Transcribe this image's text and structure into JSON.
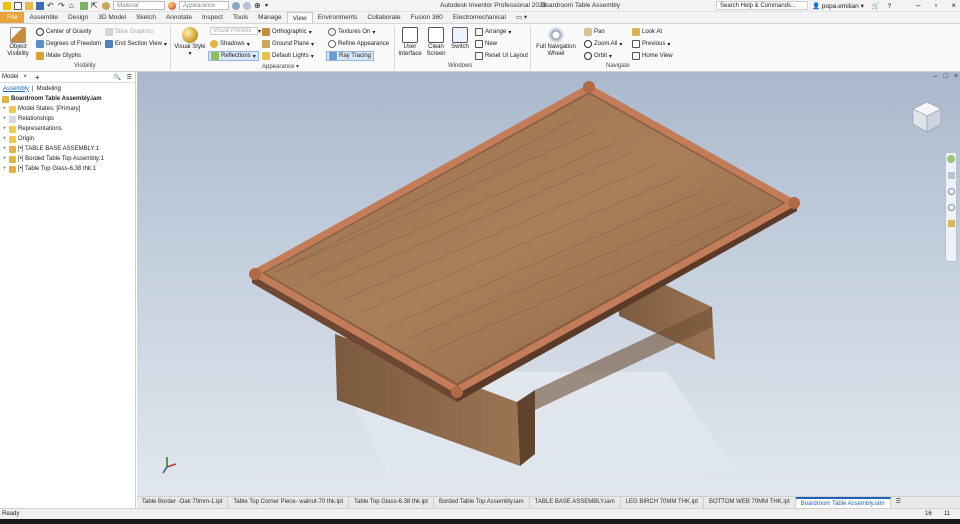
{
  "titlebar": {
    "material_placeholder": "Material",
    "appearance_placeholder": "Appearance",
    "app_title": "Autodesk Inventor Professional 2023",
    "doc_title": "Boardroom Table Assembly",
    "search_placeholder": "Search Help & Commands...",
    "user": "popa.emilian"
  },
  "tabs": [
    "File",
    "Assemble",
    "Design",
    "3D Model",
    "Sketch",
    "Annotate",
    "Inspect",
    "Tools",
    "Manage",
    "View",
    "Environments",
    "Collaborate",
    "Fusion 360",
    "Electromechanical"
  ],
  "ribbon": {
    "visibility": {
      "object_visibility": "Object Visibility",
      "center_of_gravity": "Center of Gravity",
      "degrees_of_freedom": "Degrees of Freedom",
      "imate_glyphs": "iMate Glyphs",
      "slice_graphics": "Slice Graphics",
      "end_section_view": "End Section View",
      "label": "Visibility"
    },
    "appearance": {
      "visual_style": "Visual Style",
      "visual_presets": "Visual Presets",
      "shadows": "Shadows",
      "reflections": "Reflections",
      "orthographic": "Orthographic",
      "ground_plane": "Ground Plane",
      "default_lights": "Default Lights",
      "textures_on": "Textures On",
      "refine_appearance": "Refine Appearance",
      "ray_tracing": "Ray Tracing",
      "label": "Appearance"
    },
    "windows": {
      "user_interface": "User Interface",
      "clean_screen": "Clean Screen",
      "switch": "Switch",
      "arrange": "Arrange",
      "new": "New",
      "reset_ui_layout": "Reset UI Layout",
      "label": "Windows"
    },
    "navigate": {
      "full_navigation_wheel": "Full Navigation Wheel",
      "pan": "Pan",
      "zoom_all": "Zoom All",
      "orbit": "Orbit",
      "look_at": "Look At",
      "previous": "Previous",
      "home_view": "Home View",
      "label": "Navigate"
    }
  },
  "browser": {
    "title": "Model",
    "tab_assembly": "Assembly",
    "tab_modeling": "Modeling",
    "root": "Boardroom Table Assembly.iam",
    "items": [
      "Model States: [Primary]",
      "Relationships",
      "Representations",
      "Origin",
      "[•] TABLE BASE ASSEMBLY:1",
      "[•] Borded Table Top Assembly:1",
      "[•] Table Top Glass-6.38 thk:1"
    ]
  },
  "doc_tabs": [
    "Table Border -Oak 70mm-1.ipt",
    "Table Top Corner Piece- walnut-70 thk.ipt",
    "Table Top Glass-6.38 thk.ipt",
    "Borded Table Top Assembly.iam",
    "TABLE BASE ASSEMBLY.iam",
    "LEG BIRCH 70MM THK.ipt",
    "BOTTOM WEB 70MM THK.ipt",
    "Boardroom Table Assembly.iam"
  ],
  "active_doc_tab": 7,
  "status": {
    "text": "Ready",
    "count_a": "16",
    "count_b": "11"
  },
  "colors": {
    "file_tab": "#e8a33d",
    "accent": "#1d62b7",
    "wood_light": "#a77a55",
    "wood_dark": "#7a553a",
    "border_copper": "#c07a55"
  }
}
